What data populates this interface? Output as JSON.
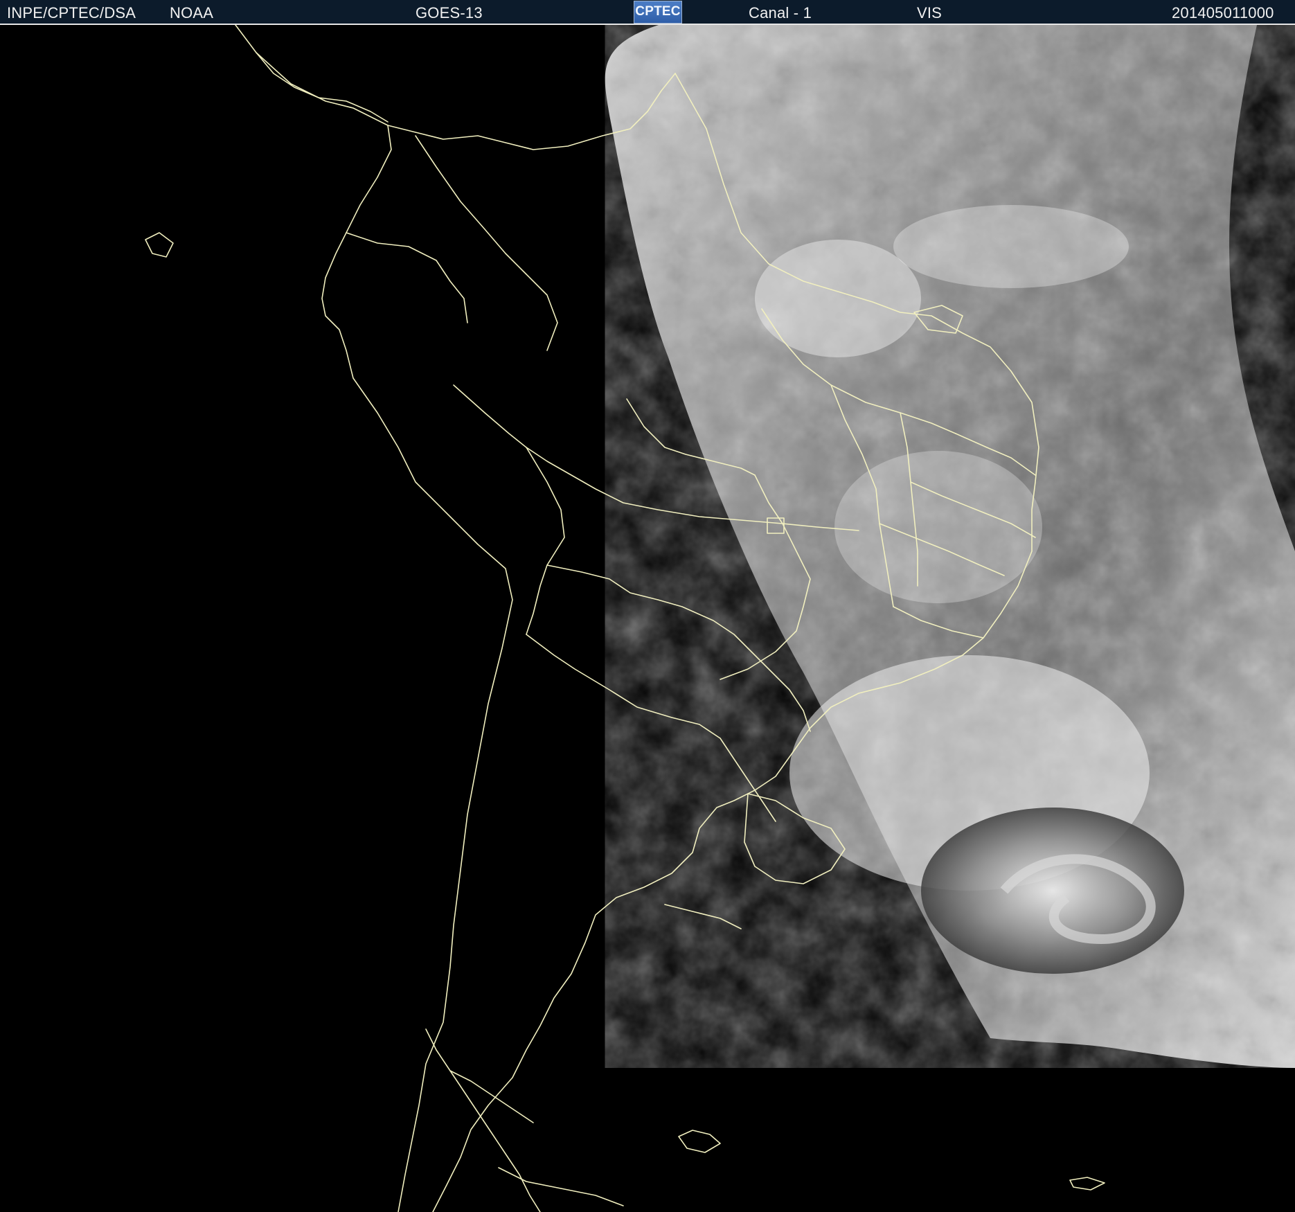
{
  "header": {
    "left_label": "INPE/CPTEC/DSA",
    "agency": "NOAA",
    "satellite": "GOES-13",
    "logo_text": "CPTEC",
    "channel": "Canal - 1",
    "band": "VIS",
    "timestamp": "201405011000"
  },
  "colors": {
    "background": "#000000",
    "topbar": "#0c1b2b",
    "coastline": "#f1efbf",
    "cloud_light": "#f5f5f5",
    "cloud_mid": "#8d8d8d",
    "cloud_dark": "#333333"
  }
}
